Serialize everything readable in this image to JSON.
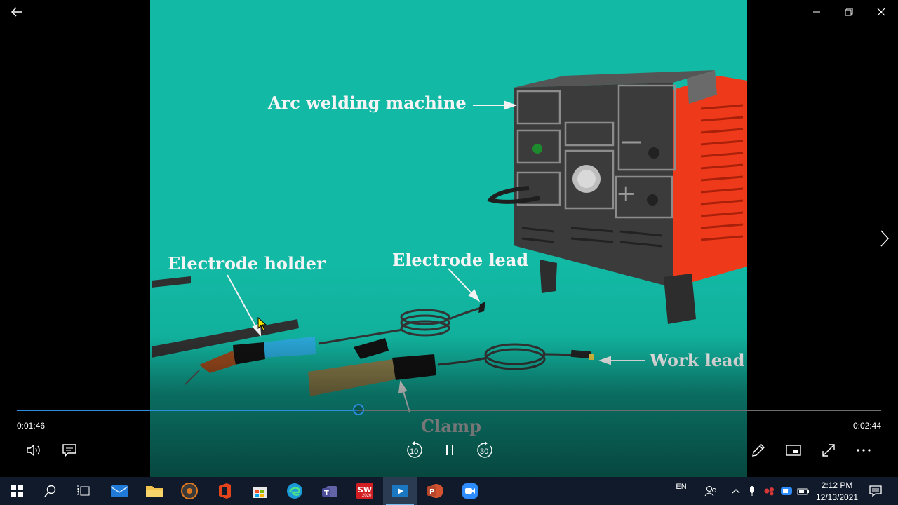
{
  "video": {
    "labels": {
      "machine": "Arc welding machine",
      "electrode_holder": "Electrode holder",
      "electrode_lead": "Electrode lead",
      "work_lead": "Work lead",
      "clamp": "Clamp"
    }
  },
  "player": {
    "elapsed": "0:01:46",
    "duration": "0:02:44",
    "progress_fraction": 0.395,
    "skip_back_label": "10",
    "skip_forward_label": "30",
    "accent_color": "#2c8ee0"
  },
  "window_controls": [
    "back-arrow-icon",
    "minimize-icon",
    "restore-icon",
    "close-icon"
  ],
  "taskbar": {
    "apps": [
      "windows-start-icon",
      "search-icon",
      "task-view-icon",
      "mail-icon",
      "file-explorer-icon",
      "media-app-icon",
      "office-icon",
      "microsoft-store-icon",
      "edge-icon",
      "teams-icon",
      "solidworks-icon",
      "video-player-icon",
      "powerpoint-icon",
      "zoom-icon"
    ],
    "solidworks_badge": "2020",
    "language": "EN",
    "time": "2:12 PM",
    "date": "12/13/2021"
  }
}
